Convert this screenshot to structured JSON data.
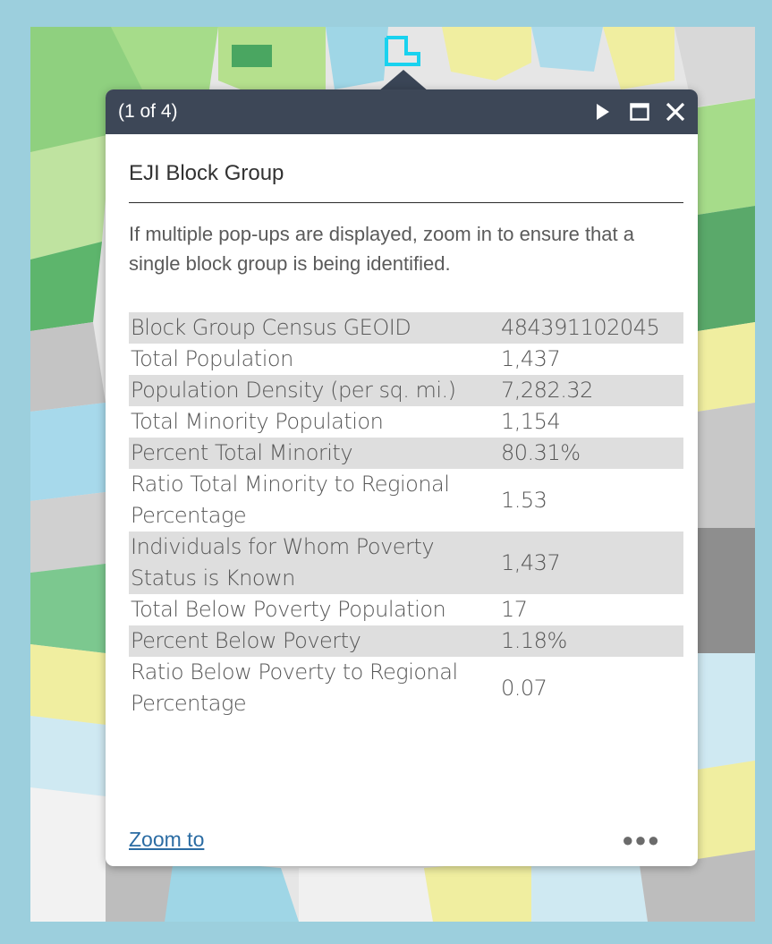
{
  "popup": {
    "counter": "(1 of 4)",
    "title": "EJI Block Group",
    "description": "If multiple pop-ups are displayed, zoom in to ensure that a single block group is being identified.",
    "fields": [
      {
        "label": "Block Group Census GEOID",
        "value": "484391102045"
      },
      {
        "label": "Total Population",
        "value": "1,437"
      },
      {
        "label": "Population Density (per sq. mi.)",
        "value": "7,282.32"
      },
      {
        "label": "Total Minority Population",
        "value": "1,154"
      },
      {
        "label": "Percent Total Minority",
        "value": "80.31%"
      },
      {
        "label": "Ratio Total Minority to Regional Percentage",
        "value": "1.53"
      },
      {
        "label": "Individuals for Whom Poverty Status is Known",
        "value": "1,437"
      },
      {
        "label": "Total Below Poverty Population",
        "value": "17"
      },
      {
        "label": "Percent Below Poverty",
        "value": "1.18%"
      },
      {
        "label": "Ratio Below Poverty to Regional Percentage",
        "value": "0.07"
      }
    ],
    "zoom_label": "Zoom to",
    "more_glyph": "●●●"
  },
  "icons": {
    "next": "play-icon",
    "maximize": "maximize-icon",
    "close": "close-icon",
    "selected_feature": "selected-block-outline-icon"
  },
  "colors": {
    "frame": "#9ccfdd",
    "header": "#3d4757",
    "row_alt": "#dedede",
    "link": "#2b6ca3",
    "highlight": "#19d2ef"
  }
}
